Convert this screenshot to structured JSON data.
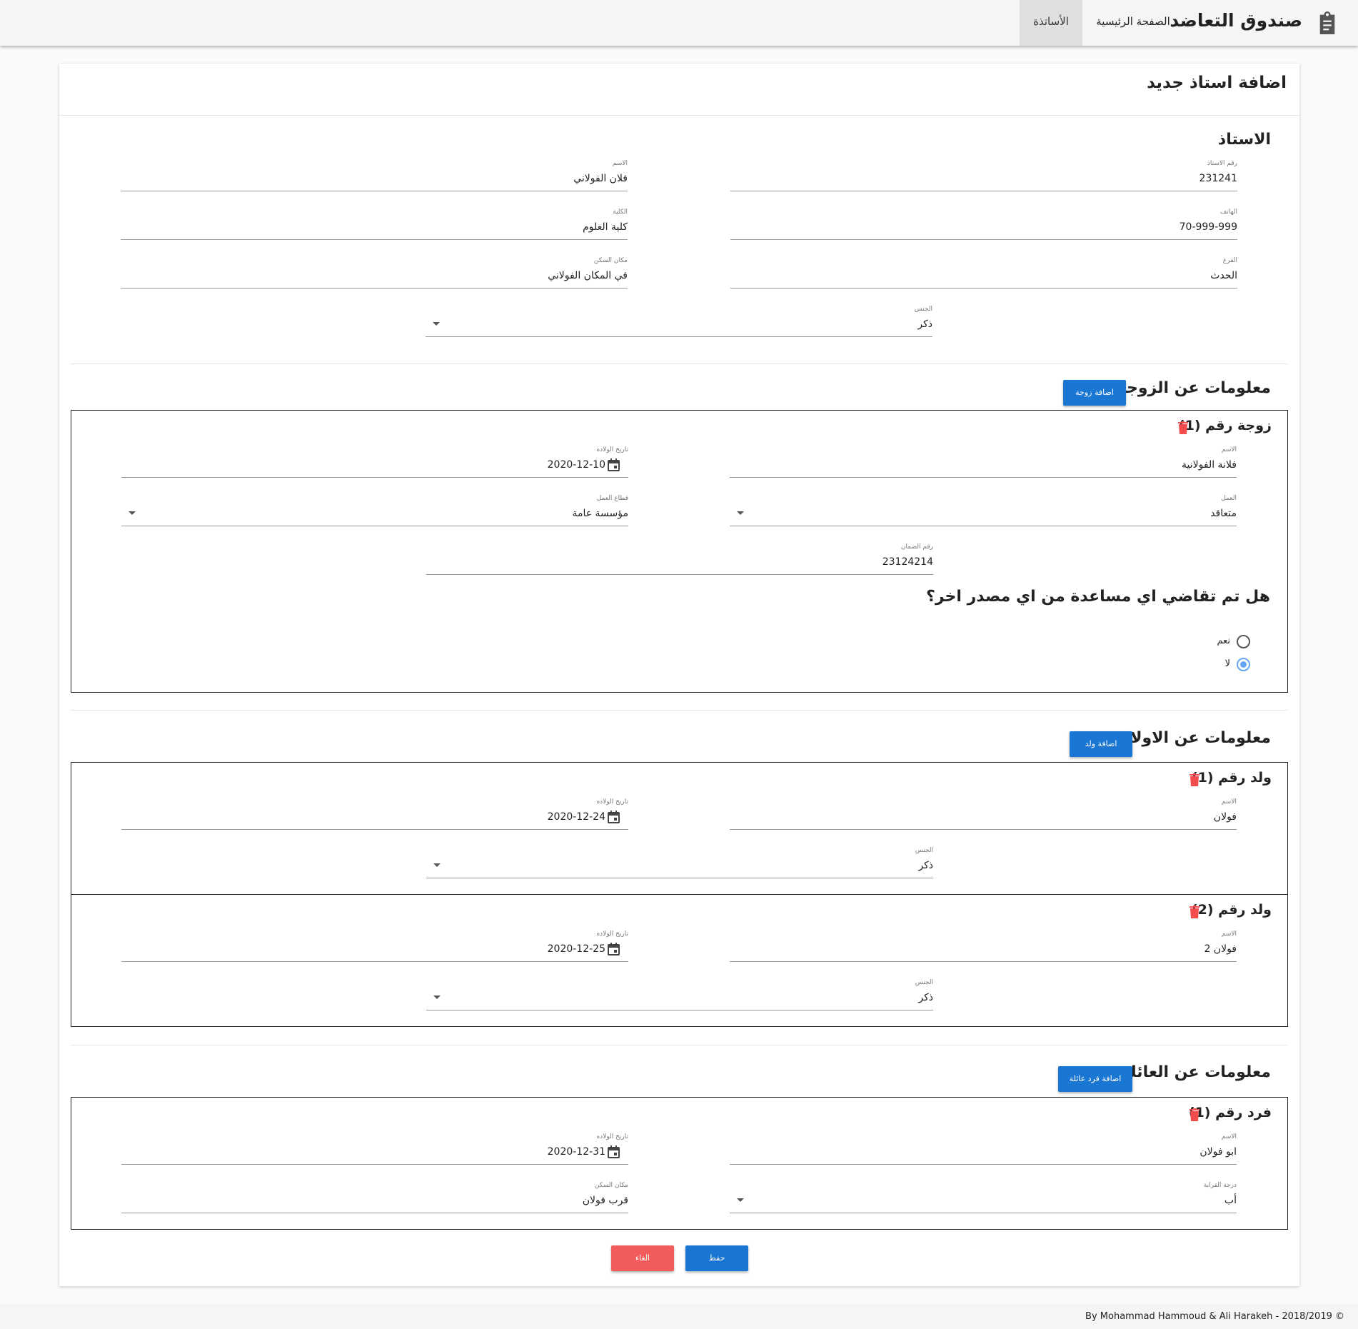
{
  "nav": {
    "brand": "صندوق التعاضد",
    "brand_icon": "clipboard-icon",
    "items": [
      {
        "label": "الصفحة الرئيسية",
        "active": false
      },
      {
        "label": "الأساتذة",
        "active": true
      }
    ]
  },
  "page": {
    "title": "اضافة استاذ جديد"
  },
  "teacher": {
    "heading": "الاستاذ",
    "fields": {
      "number": {
        "label": "رقم الاستاذ",
        "value": "231241"
      },
      "name": {
        "label": "الاسم",
        "value": "فلان الفولاني"
      },
      "phone": {
        "label": "الهاتف",
        "value": "70-999-999"
      },
      "faculty": {
        "label": "الكلية",
        "value": "كلية العلوم"
      },
      "branch": {
        "label": "الفرع",
        "value": "الحدث"
      },
      "residence": {
        "label": "مكان السكن",
        "value": "في المكان الفولاني"
      },
      "gender": {
        "label": "الجنس",
        "value": "ذكر"
      }
    }
  },
  "wives": {
    "heading": "معلومات عن الزوجة",
    "add_label": "اضافة زوجة",
    "items": [
      {
        "title": "زوجة رقم (1)",
        "name": {
          "label": "الاسم",
          "value": "فلانة الفولانية"
        },
        "birthdate": {
          "label": "تاريخ الولاده",
          "value": "2020-12-10"
        },
        "work": {
          "label": "العمل",
          "value": "متعاقد"
        },
        "sector": {
          "label": "قطاع العمل",
          "value": "مؤسسة عامة"
        },
        "insurance": {
          "label": "رقم الضمان",
          "value": "23124214"
        },
        "question": "هل تم تقاضي اي مساعدة من اي مصدر اخر؟",
        "options": [
          {
            "label": "نعم",
            "checked": false
          },
          {
            "label": "لا",
            "checked": true
          }
        ]
      }
    ]
  },
  "children": {
    "heading": "معلومات عن الاولاد",
    "add_label": "اضافة ولد",
    "items": [
      {
        "title": "ولد رقم (1)",
        "name": {
          "label": "الاسم",
          "value": "فولان"
        },
        "birthdate": {
          "label": "تاريخ الولاده",
          "value": "2020-12-24"
        },
        "gender": {
          "label": "الجنس",
          "value": "ذكر"
        }
      },
      {
        "title": "ولد رقم (2)",
        "name": {
          "label": "الاسم",
          "value": "فولان 2"
        },
        "birthdate": {
          "label": "تاريخ الولاده",
          "value": "2020-12-25"
        },
        "gender": {
          "label": "الجنس",
          "value": "ذكر"
        }
      }
    ]
  },
  "family": {
    "heading": "معلومات عن العائلة",
    "add_label": "اضافة فرد عائلة",
    "items": [
      {
        "title": "فرد رقم (1)",
        "name": {
          "label": "الاسم",
          "value": "ابو فولان"
        },
        "birthdate": {
          "label": "تاريخ الولاده",
          "value": "2020-12-31"
        },
        "relation": {
          "label": "درجة القرابة",
          "value": "أب"
        },
        "residence": {
          "label": "مكان السكن",
          "value": "قرب فولان"
        }
      }
    ]
  },
  "actions": {
    "save_label": "حفظ",
    "cancel_label": "الغاء"
  },
  "colors": {
    "primary": "#1976d2",
    "danger": "#f25b5b",
    "radio": "#64a5f0"
  },
  "footer": {
    "text": "By Mohammad Hammoud & Ali Harakeh - 2018/2019 ©"
  }
}
